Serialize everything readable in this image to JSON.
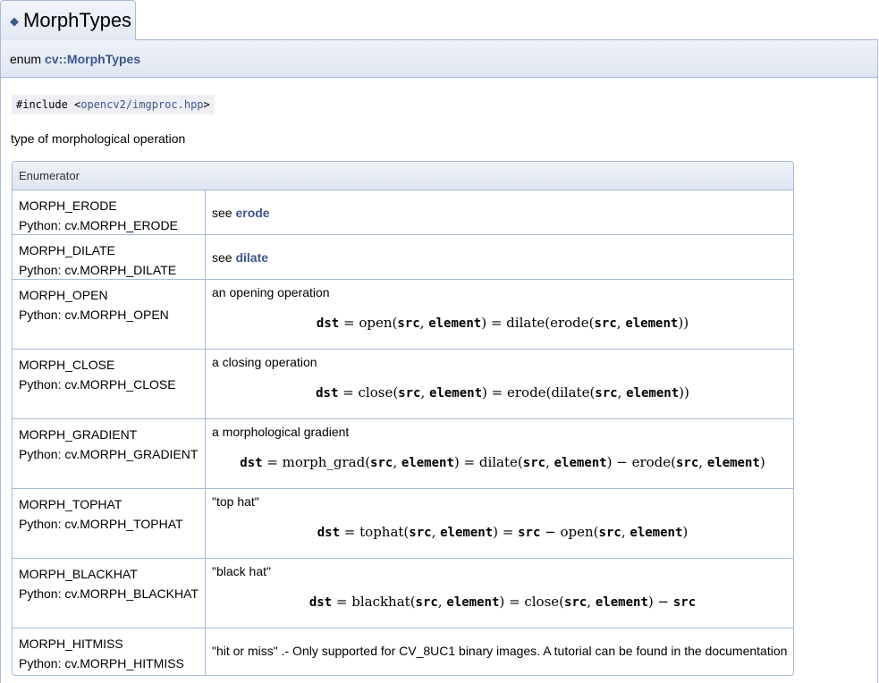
{
  "tab": {
    "icon": "diamond-icon",
    "title": "MorphTypes"
  },
  "prototype": {
    "keyword": "enum",
    "name": "cv::MorphTypes"
  },
  "include": {
    "prefix": "#include <",
    "path": "opencv2/imgproc.hpp",
    "suffix": ">"
  },
  "description": "type of morphological operation",
  "table": {
    "header": "Enumerator",
    "rows": [
      {
        "name": "MORPH_ERODE",
        "python": "Python: cv.MORPH_ERODE",
        "text": "see ",
        "link": "erode"
      },
      {
        "name": "MORPH_DILATE",
        "python": "Python: cv.MORPH_DILATE",
        "text": "see ",
        "link": "dilate"
      },
      {
        "name": "MORPH_OPEN",
        "python": "Python: cv.MORPH_OPEN",
        "text": "an opening operation",
        "formula": "dst = open(src, element) = dilate(erode(src, element))"
      },
      {
        "name": "MORPH_CLOSE",
        "python": "Python: cv.MORPH_CLOSE",
        "text": "a closing operation",
        "formula": "dst = close(src, element) = erode(dilate(src, element))"
      },
      {
        "name": "MORPH_GRADIENT",
        "python": "Python: cv.MORPH_GRADIENT",
        "text": "a morphological gradient",
        "formula": "dst = morph_grad(src, element) = dilate(src, element) − erode(src, element)"
      },
      {
        "name": "MORPH_TOPHAT",
        "python": "Python: cv.MORPH_TOPHAT",
        "text": "\"top hat\"",
        "formula": "dst = tophat(src, element) = src − open(src, element)"
      },
      {
        "name": "MORPH_BLACKHAT",
        "python": "Python: cv.MORPH_BLACKHAT",
        "text": "\"black hat\"",
        "formula": "dst = blackhat(src, element) = close(src, element) − src"
      },
      {
        "name": "MORPH_HITMISS",
        "python": "Python: cv.MORPH_HITMISS",
        "text": "\"hit or miss\" .- Only supported for CV_8UC1 binary images. A tutorial can be found in the documentation"
      }
    ]
  }
}
